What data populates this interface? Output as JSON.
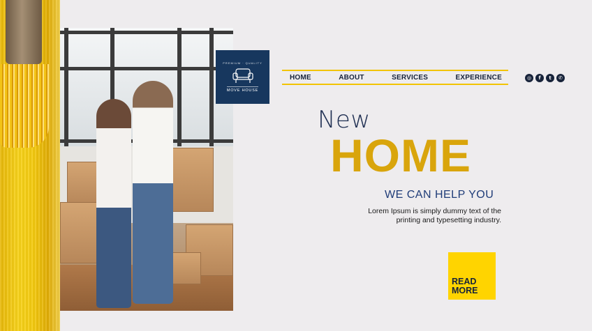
{
  "logo": {
    "arc_text": "PREMIUM · QUALITY",
    "brand": "MOVE HOUSE"
  },
  "nav": {
    "items": [
      "HOME",
      "ABOUT",
      "SERVICES",
      "EXPERIENCE"
    ]
  },
  "social": [
    "instagram-icon",
    "facebook-icon",
    "twitter-icon",
    "whatsapp-icon"
  ],
  "hero": {
    "line1": "New",
    "line2": "HOME",
    "tagline": "WE CAN HELP YOU",
    "description": "Lorem Ipsum is simply dummy text of the printing and typesetting industry."
  },
  "cta": {
    "line1": "READ",
    "line2": "MORE"
  },
  "colors": {
    "navy": "#17375e",
    "gold": "#d9a50c",
    "yellow": "#ffd400",
    "background": "#eeecee"
  }
}
